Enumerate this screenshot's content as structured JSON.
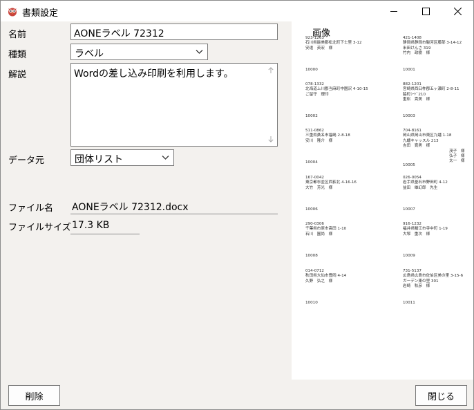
{
  "window": {
    "title": "書類設定",
    "controls": {
      "minimize": "minimize",
      "maximize": "maximize",
      "close": "close"
    }
  },
  "form": {
    "name_label": "名前",
    "name_value": "AONEラベル 72312",
    "type_label": "種類",
    "type_value": "ラベル",
    "description_label": "解説",
    "description_value": "Wordの差し込み印刷を利用します。",
    "datasource_label": "データ元",
    "datasource_value": "団体リスト",
    "filename_label": "ファイル名",
    "filename_value": "AONEラベル 72312.docx",
    "filesize_label": "ファイルサイズ",
    "filesize_value": "17.3 KB"
  },
  "preview": {
    "title": "画像",
    "labels": [
      {
        "lines": [
          "923-1263",
          "石川県能美郡松北町下士里 3-12",
          "安達　英宏　様"
        ],
        "code": "10000"
      },
      {
        "lines": [
          "421-1408",
          "静岡県静岡市駿河区藤部 3-14-12",
          "米田けんさ 319",
          "竹内　政樹　様"
        ],
        "code": "10001"
      },
      {
        "lines": [
          "078-1332",
          "北海道上川郡当麻町中園沢 4-10-15",
          "ご留守　理印"
        ],
        "code": "10002"
      },
      {
        "lines": [
          "882-1201",
          "宮崎県西臼杵郡五ヶ瀬町 2-8-11",
          "脇町ｼｰﾄﾞ210",
          "重松　貴美　様"
        ],
        "code": "10003"
      },
      {
        "lines": [
          "511-0862",
          "三重県桑名市福嶋 2-8-18",
          "安川　隆介　様"
        ],
        "code": "10004"
      },
      {
        "lines": [
          "704-8161",
          "岡山県岡山市東区九蟠 1-18",
          "九蟠キャッスル 213",
          "吉田　寛男　様",
          "　　　　　　　　　　　　茂子　様",
          "　　　　　　　　　　　　弘子　様",
          "　　　　　　　　　　　　太一　様"
        ],
        "code": "10005"
      },
      {
        "lines": [
          "167-0042",
          "東京都杉並区西荻北 4-16-16",
          "大竹　芳光　様"
        ],
        "code": "10006"
      },
      {
        "lines": [
          "026-0054",
          "岩手県釜石市野田町 4-12",
          "益田　雄幻郎　先生"
        ],
        "code": "10007"
      },
      {
        "lines": [
          "290-0306",
          "千葉県市原市高田 1-10",
          "石川　圓尚　様"
        ],
        "code": "10008"
      },
      {
        "lines": [
          "916-1232",
          "福井県鯖江市寺中町 1-19",
          "大塚　重次　様"
        ],
        "code": "10009"
      },
      {
        "lines": [
          "014-0712",
          "秋田県大仙市豊岡 4-14",
          "久野　弘之　様"
        ],
        "code": "10010"
      },
      {
        "lines": [
          "731-5137",
          "広島県広島市佐伯区美の里 3-15-6",
          "ガーデン東の里 301",
          "岩崎　秋彦　様"
        ],
        "code": "10011"
      }
    ]
  },
  "buttons": {
    "delete": "削除",
    "close": "閉じる"
  }
}
